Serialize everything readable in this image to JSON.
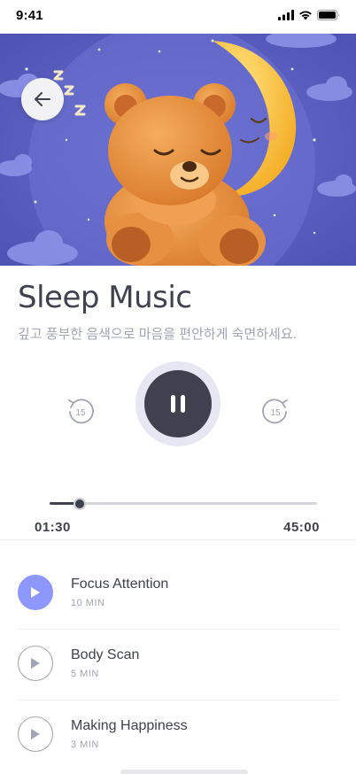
{
  "status_bar": {
    "time": "9:41"
  },
  "header": {
    "back_icon": "arrow-left-icon"
  },
  "hero": {
    "illustration": "sleeping-bear-with-moon",
    "zz_text": "ZZZ"
  },
  "content": {
    "title": "Sleep Music",
    "subtitle": "깊고 풍부한 음색으로 마음을 편안하게 숙면하세요."
  },
  "player": {
    "skip_back_label": "15",
    "skip_forward_label": "15",
    "state": "playing",
    "current_time": "01:30",
    "total_time": "45:00",
    "progress_fraction": 0.0333
  },
  "tracks": [
    {
      "title": "Focus Attention",
      "duration": "10 MIN",
      "active": true
    },
    {
      "title": "Body Scan",
      "duration": "5 MIN",
      "active": false
    },
    {
      "title": "Making Happiness",
      "duration": "3 MIN",
      "active": false
    }
  ],
  "colors": {
    "accent": "#8e97fd",
    "dark": "#3f414e",
    "muted": "#a1a4b2",
    "hero_bg": "#5a5fbf"
  }
}
